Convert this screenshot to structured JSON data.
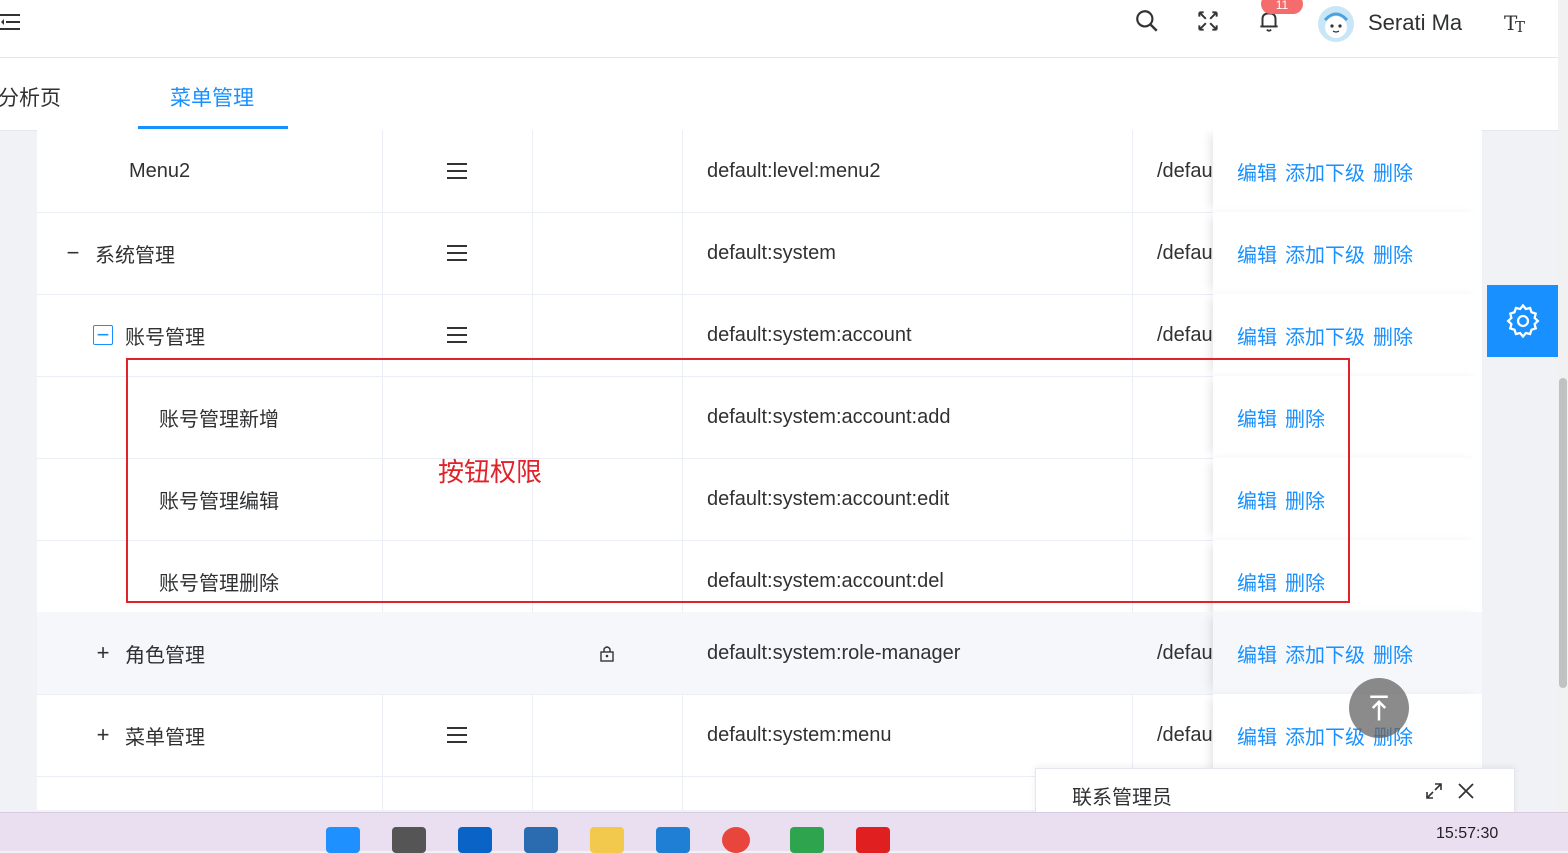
{
  "header": {
    "username": "Serati Ma",
    "notification_count": "11"
  },
  "tabs": [
    {
      "label": "分析页"
    },
    {
      "label": "菜单管理"
    }
  ],
  "table": {
    "rows": [
      {
        "name": "Menu2",
        "icon": "menu-icon",
        "permission": "default:level:menu2",
        "path": "/defau",
        "ops": [
          "编辑",
          "添加下级",
          "删除"
        ]
      },
      {
        "name": "系统管理",
        "expander": "−",
        "icon": "menu-icon",
        "permission": "default:system",
        "path": "/defau",
        "ops": [
          "编辑",
          "添加下级",
          "删除"
        ]
      },
      {
        "name": "账号管理",
        "expander": "−",
        "icon": "menu-icon",
        "permission": "default:system:account",
        "path": "/defau",
        "ops": [
          "编辑",
          "添加下级",
          "删除"
        ]
      },
      {
        "name": "账号管理新增",
        "permission": "default:system:account:add",
        "path": "",
        "ops": [
          "编辑",
          "删除"
        ]
      },
      {
        "name": "账号管理编辑",
        "permission": "default:system:account:edit",
        "path": "",
        "ops": [
          "编辑",
          "删除"
        ]
      },
      {
        "name": "账号管理删除",
        "permission": "default:system:account:del",
        "path": "",
        "ops": [
          "编辑",
          "删除"
        ]
      },
      {
        "name": "角色管理",
        "expander": "+",
        "icon": "lock-icon",
        "permission": "default:system:role-manager",
        "path": "/defau",
        "ops": [
          "编辑",
          "添加下级",
          "删除"
        ]
      },
      {
        "name": "菜单管理",
        "expander": "+",
        "icon": "menu-icon",
        "permission": "default:system:menu",
        "path": "/defau",
        "ops": [
          "编辑",
          "添加下级",
          "删除"
        ]
      }
    ]
  },
  "annotation": {
    "label": "按钮权限"
  },
  "contact": {
    "title": "联系管理员"
  },
  "taskbar": {
    "time": "15:57:30"
  },
  "colors": {
    "primary": "#1890ff",
    "annotation": "#e0222a"
  }
}
